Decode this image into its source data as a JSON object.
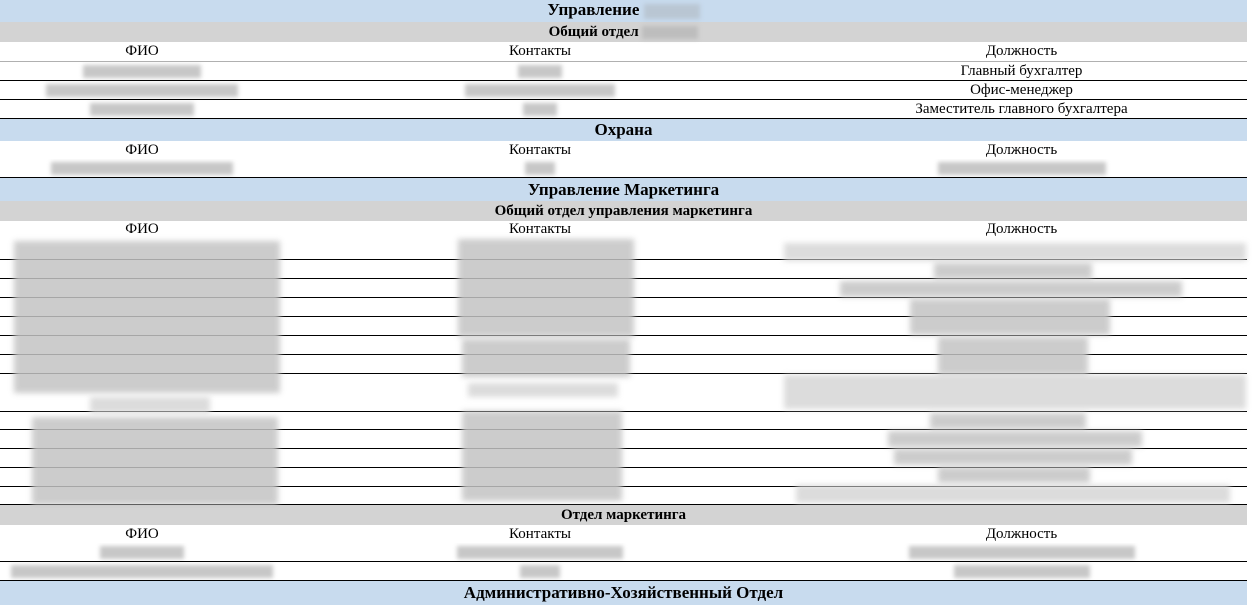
{
  "sections": {
    "dept1_title": "Управление",
    "dept1_sub": "Общий отдел",
    "security_title": "Охрана",
    "marketing_title": "Управление Маркетинга",
    "marketing_sub1": "Общий отдел управления маркетинга",
    "marketing_sub2": "Отдел маркетинга",
    "admin_title": "Административно-Хозяйственный Отдел"
  },
  "columns": {
    "name": "ФИО",
    "contacts": "Контакты",
    "position": "Должность"
  },
  "general_dept_rows": [
    {
      "position": "Главный бухгалтер"
    },
    {
      "position": "Офис-менеджер"
    },
    {
      "position": "Заместитель главного бухгалтера"
    }
  ]
}
